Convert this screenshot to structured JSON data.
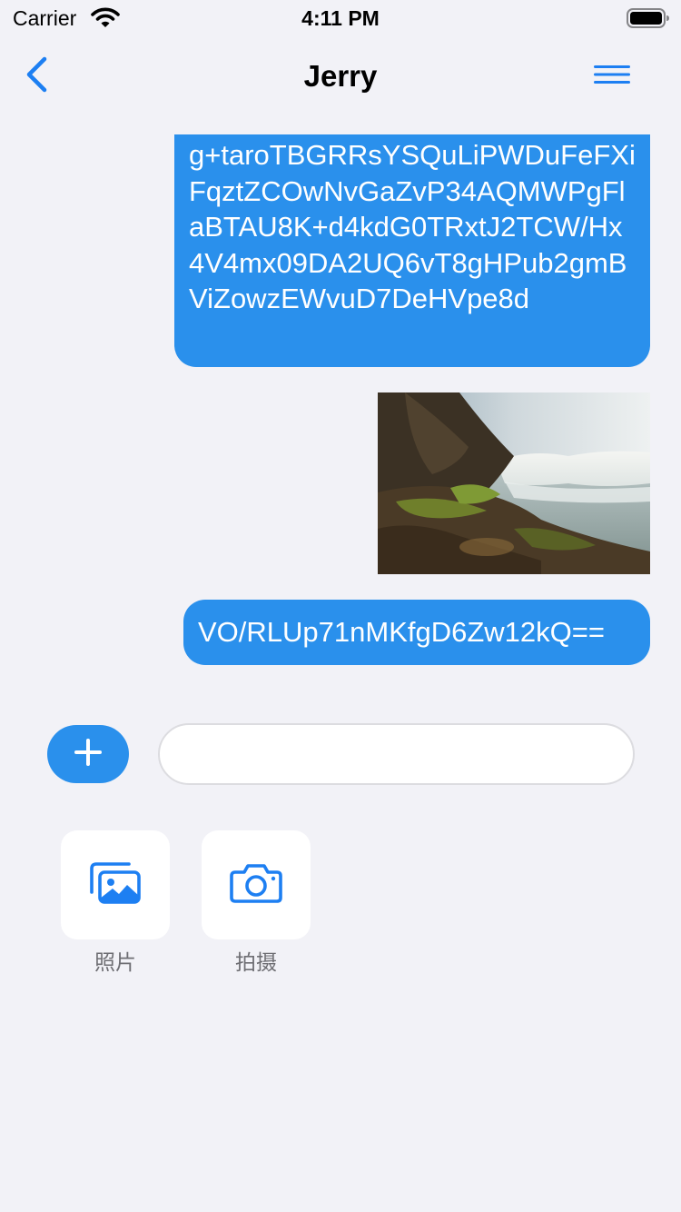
{
  "status_bar": {
    "carrier": "Carrier",
    "time": "4:11 PM",
    "icons": [
      "wifi-icon",
      "battery-icon"
    ]
  },
  "nav": {
    "title": "Jerry",
    "back_icon": "chevron-left-icon",
    "menu_icon": "menu-icon"
  },
  "messages": [
    {
      "type": "text",
      "text": "g+taroTBGRRsYSQuLiPWDuFeFXiFqztZCOwNvGaZvP34AQMWPgFlaBTAU8K+d4kdG0TRxtJ2TCW/Hx4V4mx09DA2UQ6vT8gHPub2gmBViZowzEWvuD7DeHVpe8d"
    },
    {
      "type": "image",
      "description": "waterfall-photo"
    },
    {
      "type": "text",
      "text": "VO/RLUp71nMKfgD6Zw12kQ=="
    }
  ],
  "composer": {
    "add_icon": "plus-icon",
    "input_value": "",
    "input_placeholder": ""
  },
  "tools": [
    {
      "label": "照片",
      "icon": "photos-icon"
    },
    {
      "label": "拍摄",
      "icon": "camera-icon"
    }
  ],
  "colors": {
    "accent": "#2a90ec",
    "icon_blue": "#1d7ff2",
    "background": "#f2f2f7"
  }
}
